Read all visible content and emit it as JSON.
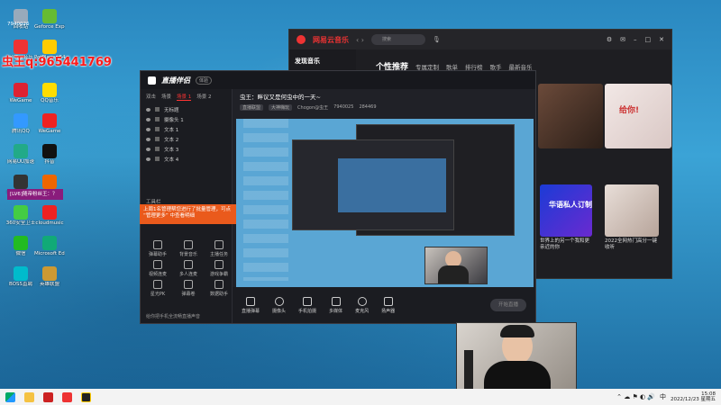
{
  "overlay": {
    "qq_label": "虫王q:965441769",
    "top_number": "7940026",
    "warn_text": "[LV6]随帝粉丝王：？"
  },
  "desktop_icons": [
    {
      "label": "回收站",
      "color": "#9ab"
    },
    {
      "label": "网易云音乐",
      "color": "#e33"
    },
    {
      "label": "WeGame",
      "color": "#d23"
    },
    {
      "label": "腾讯QQ",
      "color": "#39f"
    },
    {
      "label": "网易UU加速",
      "color": "#2a8"
    },
    {
      "label": "OBS Studio",
      "color": "#333"
    },
    {
      "label": "360安全卫士",
      "color": "#4c4"
    },
    {
      "label": "微信",
      "color": "#2b2"
    },
    {
      "label": "BOSS直聘",
      "color": "#0bc"
    },
    {
      "label": "Geforce Experience",
      "color": "#6b3"
    },
    {
      "label": "PotPlayer 64 bit",
      "color": "#fc0"
    },
    {
      "label": "QQ音乐",
      "color": "#fd0"
    },
    {
      "label": "WeGame",
      "color": "#e22"
    },
    {
      "label": "抖音",
      "color": "#111"
    },
    {
      "label": "火绒安全",
      "color": "#e60"
    },
    {
      "label": "cloudmusic",
      "color": "#e22"
    },
    {
      "label": "Microsoft Edge",
      "color": "#1a7"
    },
    {
      "label": "英雄联盟",
      "color": "#c93"
    }
  ],
  "music": {
    "logo": "网易云音乐",
    "search_placeholder": "搜索",
    "nav_header": "发现音乐",
    "tabs": [
      "个性推荐",
      "专属定制",
      "歌单",
      "排行榜",
      "歌手",
      "最新音乐"
    ],
    "captions": [
      "世界上的另一个我和更亲近的你",
      "2022全网热门高分一键收听"
    ],
    "card_badge": "华语私人订制"
  },
  "obs": {
    "brand": "直播伴侣",
    "version_pill": "体验",
    "scene_tabs": [
      "双击",
      "场景",
      "场景 1",
      "场景 2"
    ],
    "sources": [
      "无标题",
      "摄像头 1",
      "文本 1",
      "文本 2",
      "文本 3",
      "文本 4"
    ],
    "streamer_name": "虫王：畔议又是何虫中的一天~",
    "tag1": "直播联盟",
    "tag2": "大神嗨玩",
    "channel": "Chogon@虫王",
    "viewers": "7940025",
    "likes": "284469",
    "tools_header": "工具栏",
    "tools": [
      "弹幕助手",
      "背景音乐",
      "主播任务",
      "视频连麦",
      "多人连麦",
      "游戏争霸",
      "星光PK",
      "弹幕卷",
      "数据助手"
    ],
    "tip_text": "上周1名管理帮您进行了批量管理，可点 “管理更多” 中查看明细",
    "bottom_buttons": [
      "直播弹幕",
      "摄像头",
      "手机拍摄",
      "多媒体",
      "麦克风",
      "扬声器"
    ],
    "golive_label": "开始直播",
    "bottom_hint": "给你把手机全流畅直播声音"
  },
  "taskbar": {
    "time": "15:08",
    "date": "2022/12/23 星期五",
    "lang": "中"
  }
}
